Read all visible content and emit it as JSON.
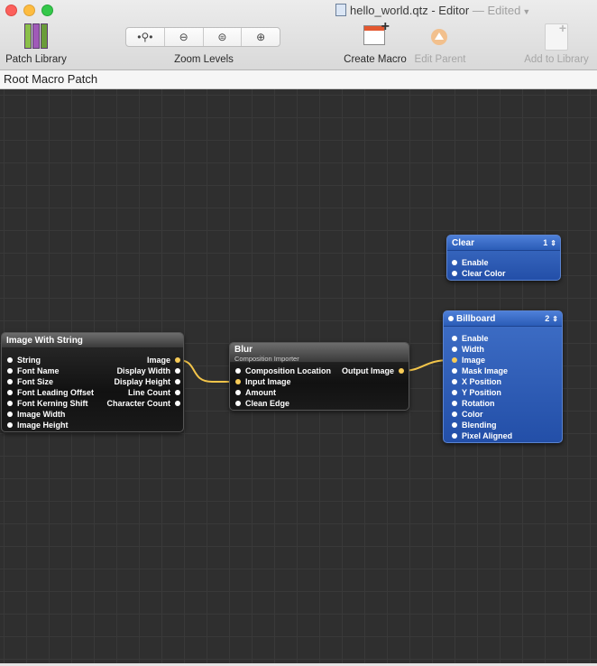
{
  "window": {
    "file_name": "hello_world.qtz",
    "title_suffix": " - Editor",
    "edited": "— Edited"
  },
  "toolbar": {
    "patch_library": "Patch Library",
    "zoom_levels": "Zoom Levels",
    "create_macro": "Create Macro",
    "edit_parent": "Edit Parent",
    "add_to_library": "Add to Library"
  },
  "path_bar": "Root Macro Patch",
  "patches": {
    "clear": {
      "title": "Clear",
      "layer": "1",
      "inputs": [
        "Enable",
        "Clear Color"
      ]
    },
    "billboard": {
      "title": "Billboard",
      "layer": "2",
      "inputs": [
        "Enable",
        "Width",
        "Image",
        "Mask Image",
        "X Position",
        "Y Position",
        "Rotation",
        "Color",
        "Blending",
        "Pixel Aligned"
      ]
    },
    "image_with_string": {
      "title": "Image With String",
      "inputs": [
        "String",
        "Font Name",
        "Font Size",
        "Font Leading Offset",
        "Font Kerning Shift",
        "Image Width",
        "Image Height"
      ],
      "outputs": [
        "Image",
        "Display Width",
        "Display Height",
        "Line Count",
        "Character Count"
      ]
    },
    "blur": {
      "title": "Blur",
      "subtitle": "Composition Importer",
      "inputs": [
        "Composition Location",
        "Input Image",
        "Amount",
        "Clean Edge"
      ],
      "outputs": [
        "Output Image"
      ]
    }
  },
  "colors": {
    "canvas": "#2f2f2f",
    "wire": "#f3c54a",
    "consumer_patch": "#2b5cb7"
  }
}
